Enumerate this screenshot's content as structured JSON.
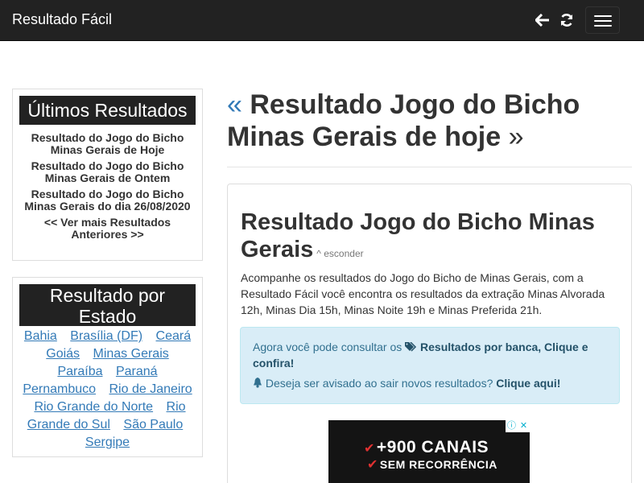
{
  "navbar": {
    "brand": "Resultado Fácil",
    "icons": [
      "arrow-left-icon",
      "refresh-icon",
      "menu-icon"
    ]
  },
  "sidebar": {
    "latest_title": "Últimos Resultados",
    "latest_links": [
      "Resultado do Jogo do Bicho Minas Gerais de Hoje",
      "Resultado do Jogo do Bicho Minas Gerais de Ontem",
      "Resultado do Jogo do Bicho Minas Gerais do dia 26/08/2020",
      "<< Ver mais Resultados Anteriores >>"
    ],
    "state_title": "Resultado por Estado",
    "states": [
      "Bahia",
      "Brasília (DF)",
      "Ceará",
      "Goiás",
      "Minas Gerais",
      "Paraíba",
      "Paraná",
      "Pernambuco",
      "Rio de Janeiro",
      "Rio Grande do Norte",
      "Rio Grande do Sul",
      "São Paulo",
      "Sergipe"
    ]
  },
  "main": {
    "left_chevron": "«",
    "title": "Resultado Jogo do Bicho Minas Gerais de hoje",
    "right_chevron": "»",
    "panel": {
      "heading": "Resultado Jogo do Bicho Minas Gerais",
      "hide_label": "^ esconder",
      "description": "Acompanhe os resultados do Jogo do Bicho de Minas Gerais, com a Resultado Fácil você encontra os resultados da extração Minas Alvorada 12h, Minas Dia 15h, Minas Noite 19h e Minas Preferida 21h.",
      "alert": {
        "line1_text": "Agora você pode consultar os",
        "line1_link": "Resultados por banca, Clique e confira!",
        "line2_text": "Deseja ser avisado ao sair novos resultados?",
        "line2_link": "Clique aqui!"
      },
      "ad": {
        "line1": "+900 CANAIS",
        "line2": "SEM RECORRÊNCIA",
        "check": "✔",
        "info": "ⓘ",
        "close": "✕"
      }
    }
  },
  "colors": {
    "navbar_bg": "#222222",
    "link_blue": "#337ab7",
    "alert_bg": "#d9edf7",
    "alert_text": "#31708f"
  }
}
